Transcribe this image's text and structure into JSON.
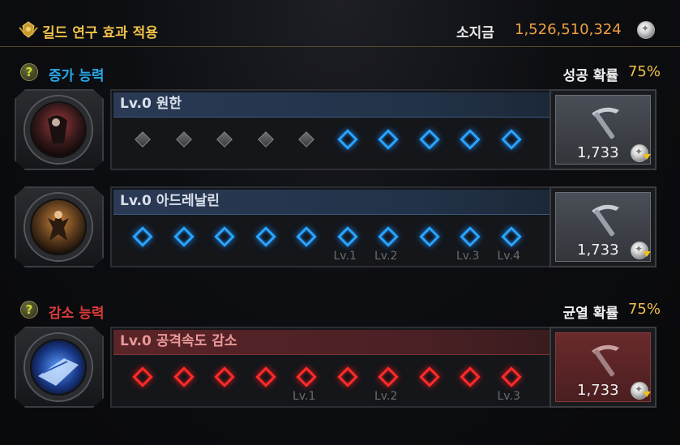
{
  "header": {
    "title": "길드 연구 효과 적용",
    "money_label": "소지금",
    "money_value": "1,526,510,324",
    "icon": "guild-crest-icon"
  },
  "increase": {
    "title": "증가 능력",
    "title_color": "#2aa8e8",
    "prob_label": "성공 확률",
    "prob_value": "75%"
  },
  "decrease": {
    "title": "감소 능력",
    "title_color": "#e03a3a",
    "prob_label": "균열 확률",
    "prob_value": "75%"
  },
  "rows": [
    {
      "name": "Lv.0 원한",
      "theme": "blue",
      "slots": [
        "off",
        "off",
        "off",
        "off",
        "off",
        "blue",
        "blue",
        "blue",
        "blue",
        "blue"
      ],
      "level_labels": [
        "",
        "",
        "",
        "",
        "",
        "",
        "",
        "",
        "",
        ""
      ],
      "cost": "1,733"
    },
    {
      "name": "Lv.0 아드레날린",
      "theme": "blue",
      "slots": [
        "blue",
        "blue",
        "blue",
        "blue",
        "blue",
        "blue",
        "blue",
        "blue",
        "blue",
        "blue"
      ],
      "level_labels": [
        "",
        "",
        "",
        "",
        "",
        "Lv.1",
        "Lv.2",
        "",
        "Lv.3",
        "Lv.4"
      ],
      "cost": "1,733"
    },
    {
      "name": "Lv.0 공격속도 감소",
      "theme": "red",
      "slots": [
        "red",
        "red",
        "red",
        "red",
        "red",
        "red",
        "red",
        "red",
        "red",
        "red"
      ],
      "level_labels": [
        "",
        "",
        "",
        "",
        "Lv.1",
        "",
        "Lv.2",
        "",
        "",
        "Lv.3"
      ],
      "cost": "1,733"
    }
  ]
}
